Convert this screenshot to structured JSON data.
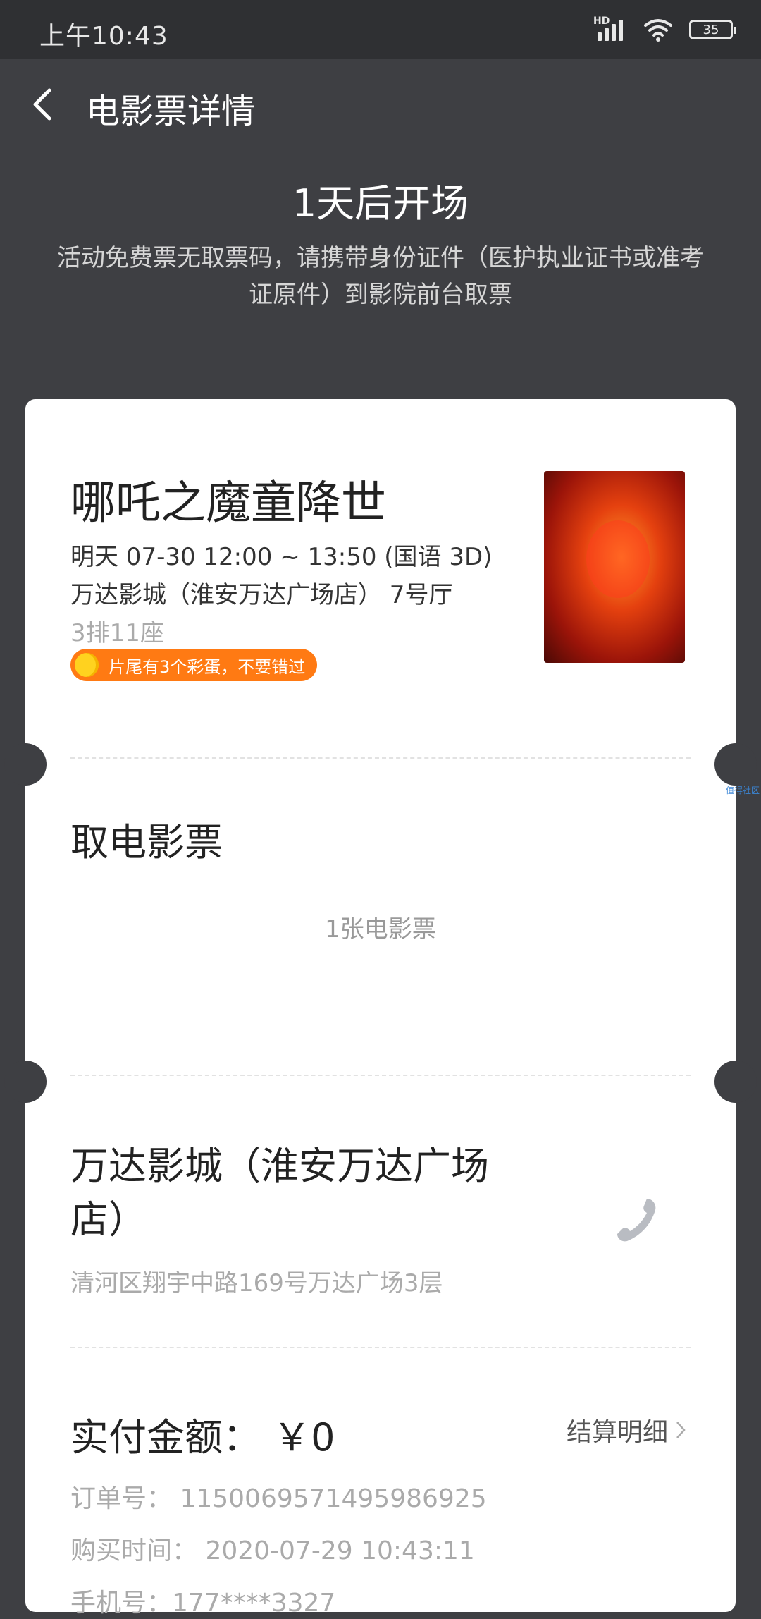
{
  "status_bar": {
    "time": "上午10:43",
    "network_label": "HD",
    "battery": "35"
  },
  "header": {
    "title": "电影票详情"
  },
  "banner": {
    "start_text": "1天后开场",
    "notice": "活动免费票无取票码，请携带身份证件（医护执业证书或准考证原件）到影院前台取票"
  },
  "movie": {
    "title": "哪吒之魔童降世",
    "showtime": "明天 07-30 12:00 ~ 13:50 (国语 3D)",
    "hall": "万达影城（淮安万达广场店） 7号厅",
    "seat": "3排11座",
    "badge": "片尾有3个彩蛋，不要错过"
  },
  "pickup": {
    "title": "取电影票",
    "count": "1张电影票"
  },
  "cinema": {
    "name": "万达影城（淮安万达广场店）",
    "address": "清河区翔宇中路169号万达广场3层"
  },
  "payment": {
    "paid": "实付金额： ￥0",
    "detail_link": "结算明细",
    "order_no": "订单号： 1150069571495986925",
    "purchase_time": "购买时间： 2020-07-29 10:43:11",
    "phone": "手机号：177****3327"
  },
  "watermark": "值得社区",
  "colors": {
    "background": "#3e3f43",
    "status_bar": "#2f3033",
    "badge": "#ff7a13",
    "card": "#ffffff"
  }
}
